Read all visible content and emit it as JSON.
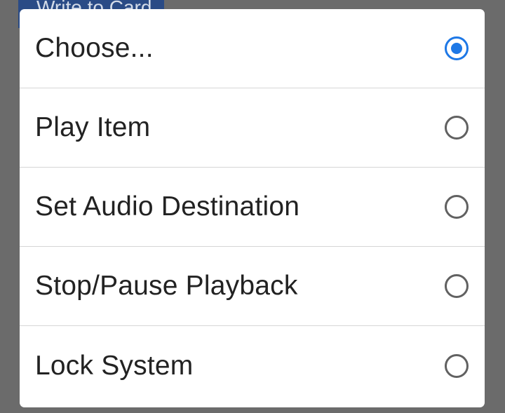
{
  "background": {
    "button_label": "Write to Card"
  },
  "dialog": {
    "selected_index": 0,
    "options": [
      {
        "label": "Choose...",
        "selected": true
      },
      {
        "label": "Play Item",
        "selected": false
      },
      {
        "label": "Set Audio Destination",
        "selected": false
      },
      {
        "label": "Stop/Pause Playback",
        "selected": false
      },
      {
        "label": "Lock System",
        "selected": false
      }
    ]
  },
  "colors": {
    "accent": "#1e78e6",
    "radio_unselected": "#616161",
    "scrim": "#6b6b6b",
    "background_button": "#2a4b86"
  }
}
